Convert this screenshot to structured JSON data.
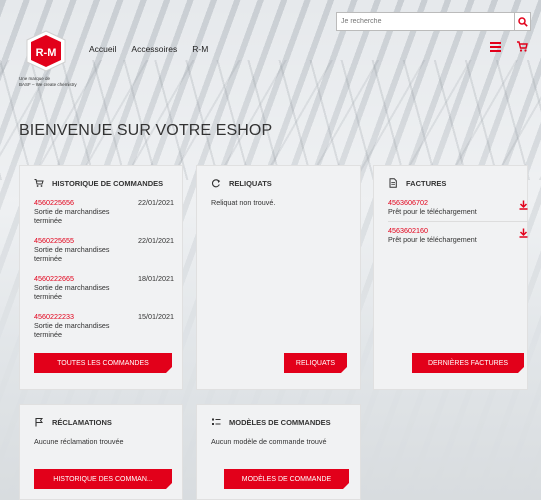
{
  "header": {
    "search_placeholder": "Je recherche",
    "nav": [
      "Accueil",
      "Accessoires",
      "R-M"
    ],
    "logo_text": "R-M",
    "logo_sub_1": "Une marque de",
    "logo_sub_2": "BASF – We create chemistry"
  },
  "welcome": "BIENVENUE SUR VOTRE ESHOP",
  "orders": {
    "title": "HISTORIQUE DE COMMANDES",
    "items": [
      {
        "num": "4560225656",
        "date": "22/01/2021",
        "status_1": "Sortie de marchandises",
        "status_2": "terminée"
      },
      {
        "num": "4560225655",
        "date": "22/01/2021",
        "status_1": "Sortie de marchandises",
        "status_2": "terminée"
      },
      {
        "num": "4560222665",
        "date": "18/01/2021",
        "status_1": "Sortie de marchandises",
        "status_2": "terminée"
      },
      {
        "num": "4560222233",
        "date": "15/01/2021",
        "status_1": "Sortie de marchandises",
        "status_2": "terminée"
      }
    ],
    "button": "TOUTES LES COMMANDES"
  },
  "backorders": {
    "title": "RELIQUATS",
    "message": "Reliquat non trouvé.",
    "button": "RELIQUATS"
  },
  "invoices": {
    "title": "FACTURES",
    "items": [
      {
        "num": "4563606702",
        "status": "Prêt pour le téléchargement"
      },
      {
        "num": "4563602160",
        "status": "Prêt pour le téléchargement"
      }
    ],
    "button": "DERNIÈRES FACTURES"
  },
  "claims": {
    "title": "RÉCLAMATIONS",
    "message": "Aucune réclamation trouvée",
    "button": "HISTORIQUE DES COMMAN..."
  },
  "templates": {
    "title": "MODÈLES DE COMMANDES",
    "message": "Aucun modèle de commande trouvé",
    "button": "MODÈLES DE COMMANDE"
  },
  "colors": {
    "accent": "#e2001a"
  }
}
